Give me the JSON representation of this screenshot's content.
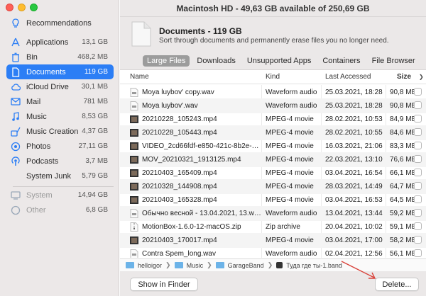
{
  "window": {
    "title": "Macintosh HD - 49,63 GB available of 250,69 GB"
  },
  "sidebar": {
    "items": [
      {
        "label": "Recommendations",
        "size": "",
        "icon": "lightbulb-icon"
      },
      {
        "label": "Applications",
        "size": "13,1 GB",
        "icon": "applications-icon"
      },
      {
        "label": "Bin",
        "size": "468,2 MB",
        "icon": "trash-icon"
      },
      {
        "label": "Documents",
        "size": "119 GB",
        "icon": "document-icon"
      },
      {
        "label": "iCloud Drive",
        "size": "30,1 MB",
        "icon": "cloud-icon"
      },
      {
        "label": "Mail",
        "size": "781 MB",
        "icon": "mail-icon"
      },
      {
        "label": "Music",
        "size": "8,53 GB",
        "icon": "music-icon"
      },
      {
        "label": "Music Creation",
        "size": "4,37 GB",
        "icon": "music-creation-icon"
      },
      {
        "label": "Photos",
        "size": "27,11 GB",
        "icon": "photos-icon"
      },
      {
        "label": "Podcasts",
        "size": "3,7 MB",
        "icon": "podcasts-icon"
      },
      {
        "label": "System Junk",
        "size": "5,79 GB",
        "icon": ""
      },
      {
        "label": "System",
        "size": "14,94 GB",
        "icon": "system-icon"
      },
      {
        "label": "Other",
        "size": "6,8 GB",
        "icon": "other-icon"
      }
    ]
  },
  "header": {
    "title": "Documents - 119 GB",
    "subtitle": "Sort through documents and permanently erase files you no longer need."
  },
  "tabs": [
    "Large Files",
    "Downloads",
    "Unsupported Apps",
    "Containers",
    "File Browser"
  ],
  "columns": {
    "name": "Name",
    "kind": "Kind",
    "last_accessed": "Last Accessed",
    "size": "Size"
  },
  "files": [
    {
      "name": "Moya luybov' copy.wav",
      "kind": "Waveform audio",
      "date": "25.03.2021, 18:28",
      "size": "90,8 MB",
      "icon": "audio-file-icon"
    },
    {
      "name": "Moya luybov'.wav",
      "kind": "Waveform audio",
      "date": "25.03.2021, 18:28",
      "size": "90,8 MB",
      "icon": "audio-file-icon"
    },
    {
      "name": "20210228_105243.mp4",
      "kind": "MPEG-4 movie",
      "date": "28.02.2021, 10:53",
      "size": "84,9 MB",
      "icon": "video-file-icon"
    },
    {
      "name": "20210228_105443.mp4",
      "kind": "MPEG-4 movie",
      "date": "28.02.2021, 10:55",
      "size": "84,6 MB",
      "icon": "video-file-icon"
    },
    {
      "name": "VIDEO_2cd66fdf-e850-421c-8b2e-…",
      "kind": "MPEG-4 movie",
      "date": "16.03.2021, 21:06",
      "size": "83,3 MB",
      "icon": "video-file-icon"
    },
    {
      "name": "MOV_20210321_1913125.mp4",
      "kind": "MPEG-4 movie",
      "date": "22.03.2021, 13:10",
      "size": "76,6 MB",
      "icon": "video-file-icon"
    },
    {
      "name": "20210403_165409.mp4",
      "kind": "MPEG-4 movie",
      "date": "03.04.2021, 16:54",
      "size": "66,1 MB",
      "icon": "video-file-icon"
    },
    {
      "name": "20210328_144908.mp4",
      "kind": "MPEG-4 movie",
      "date": "28.03.2021, 14:49",
      "size": "64,7 MB",
      "icon": "video-file-icon"
    },
    {
      "name": "20210403_165328.mp4",
      "kind": "MPEG-4 movie",
      "date": "03.04.2021, 16:53",
      "size": "64,5 MB",
      "icon": "video-file-icon"
    },
    {
      "name": "Обычно весной - 13.04.2021, 13.wav",
      "kind": "Waveform audio",
      "date": "13.04.2021, 13:44",
      "size": "59,2 MB",
      "icon": "audio-file-icon"
    },
    {
      "name": "MotionBox-1.6.0-12-macOS.zip",
      "kind": "Zip archive",
      "date": "20.04.2021, 10:02",
      "size": "59,1 MB",
      "icon": "zip-file-icon"
    },
    {
      "name": "20210403_170017.mp4",
      "kind": "MPEG-4 movie",
      "date": "03.04.2021, 17:00",
      "size": "58,2 MB",
      "icon": "video-file-icon"
    },
    {
      "name": "Contra Spem_long.wav",
      "kind": "Waveform audio",
      "date": "02.04.2021, 12:56",
      "size": "56,1 MB",
      "icon": "audio-file-icon"
    }
  ],
  "path": [
    "helloigor",
    "Music",
    "GarageBand",
    "Туда где ты-1.band"
  ],
  "buttons": {
    "show_in_finder": "Show in Finder",
    "delete": "Delete..."
  },
  "colors": {
    "accent": "#2c7ef5",
    "arrow": "#d9423a"
  }
}
